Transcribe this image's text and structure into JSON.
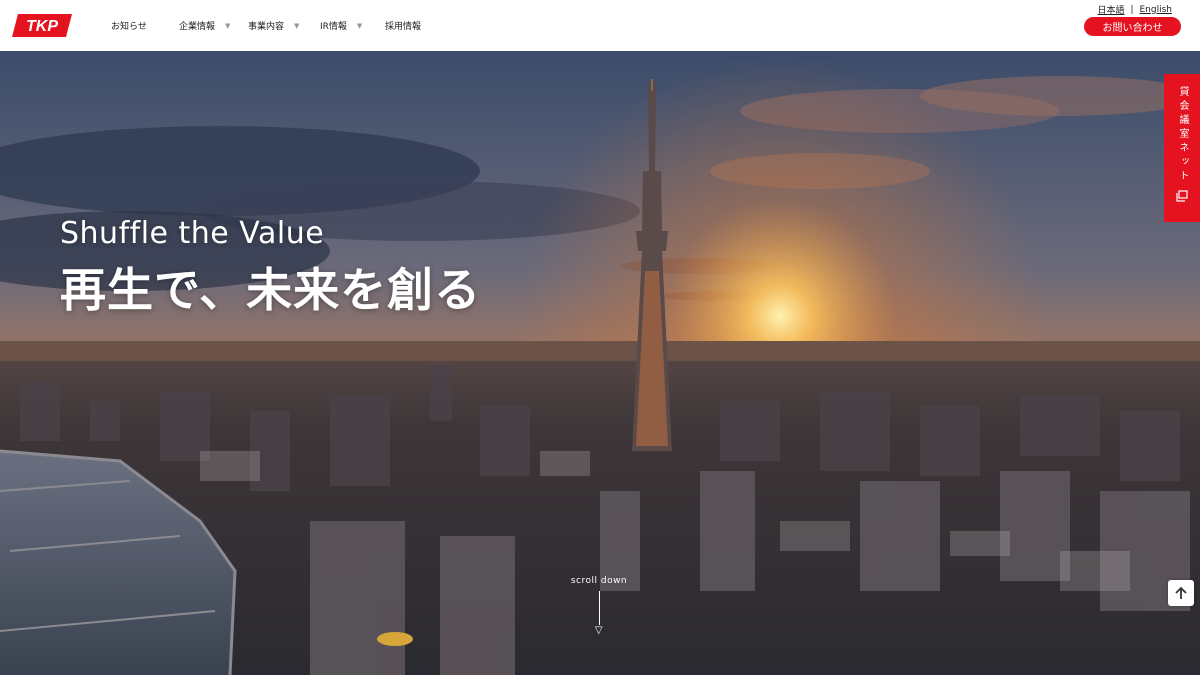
{
  "logo": {
    "text": "TKP",
    "color": "#e5121f"
  },
  "nav": [
    {
      "label": "お知らせ",
      "has_dropdown": false
    },
    {
      "label": "企業情報",
      "has_dropdown": true
    },
    {
      "label": "事業内容",
      "has_dropdown": true
    },
    {
      "label": "IR情報",
      "has_dropdown": true
    },
    {
      "label": "採用情報",
      "has_dropdown": false
    }
  ],
  "lang": {
    "ja": "日本語",
    "separator": "|",
    "en": "English"
  },
  "contact_button": "お問い合わせ",
  "hero": {
    "title_en": "Shuffle the Value",
    "title_jp": "再生で、未来を創る",
    "scroll_label": "scroll down"
  },
  "side_tab": {
    "label": "貸会議室ネット",
    "icon": "external-window-icon"
  },
  "back_to_top": {
    "icon": "arrow-up-icon"
  },
  "colors": {
    "accent": "#e5121f",
    "header_bg": "#ffffff"
  }
}
